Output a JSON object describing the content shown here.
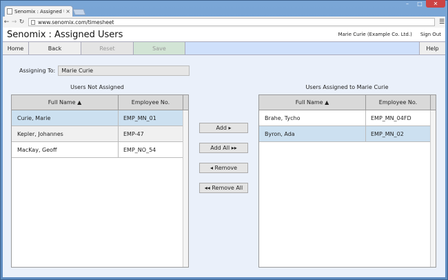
{
  "browser": {
    "tab_title": "Senomix : Assigned Users",
    "url": "www.senomix.com/timesheet"
  },
  "app": {
    "title": "Senomix : Assigned Users",
    "user": "Marie Curie  (Example Co. Ltd.)",
    "sign_out": "Sign Out"
  },
  "toolbar": {
    "home": "Home",
    "back": "Back",
    "reset": "Reset",
    "save": "Save",
    "help": "Help"
  },
  "assign": {
    "label": "Assigning To:",
    "value": "Marie Curie"
  },
  "left_list": {
    "title": "Users Not Assigned",
    "col_name": "Full Name ▲",
    "col_emp": "Employee No.",
    "rows": [
      {
        "name": "Curie, Marie",
        "emp": "EMP_MN_01"
      },
      {
        "name": "Kepler, Johannes",
        "emp": "EMP-47"
      },
      {
        "name": "MacKay, Geoff",
        "emp": "EMP_NO_54"
      }
    ]
  },
  "right_list": {
    "title": "Users Assigned to Marie Curie",
    "col_name": "Full Name ▲",
    "col_emp": "Employee No.",
    "rows": [
      {
        "name": "Brahe, Tycho",
        "emp": "EMP_MN_04FD"
      },
      {
        "name": "Byron, Ada",
        "emp": "EMP_MN_02"
      }
    ]
  },
  "actions": {
    "add": "Add ▸",
    "add_all": "Add All ▸▸",
    "remove": "◂ Remove",
    "remove_all": "◂◂ Remove All"
  }
}
